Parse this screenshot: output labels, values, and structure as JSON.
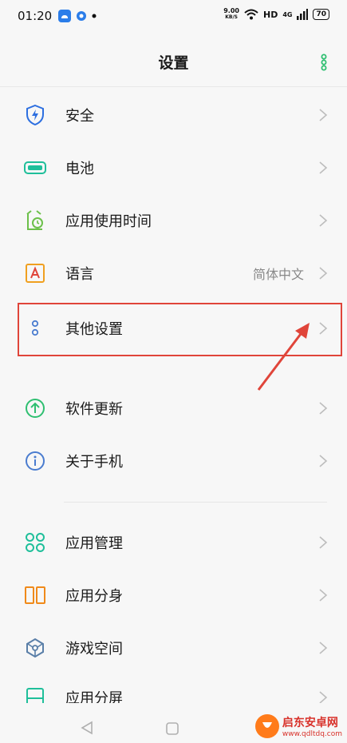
{
  "status_bar": {
    "time": "01:20",
    "network_speed_value": "9.00",
    "network_speed_unit": "KB/S",
    "hd": "HD",
    "signal": "4G",
    "battery": "70"
  },
  "header": {
    "title": "设置"
  },
  "settings": [
    {
      "label": "安全",
      "icon": "shield-icon",
      "value": ""
    },
    {
      "label": "电池",
      "icon": "battery-icon",
      "value": ""
    },
    {
      "label": "应用使用时间",
      "icon": "app-time-icon",
      "value": ""
    },
    {
      "label": "语言",
      "icon": "language-icon",
      "value": "简体中文"
    },
    {
      "label": "其他设置",
      "icon": "other-settings-icon",
      "value": ""
    },
    {
      "label": "软件更新",
      "icon": "update-icon",
      "value": ""
    },
    {
      "label": "关于手机",
      "icon": "info-icon",
      "value": ""
    },
    {
      "label": "应用管理",
      "icon": "app-management-icon",
      "value": ""
    },
    {
      "label": "应用分身",
      "icon": "app-clone-icon",
      "value": ""
    },
    {
      "label": "游戏空间",
      "icon": "game-space-icon",
      "value": ""
    },
    {
      "label": "应用分屏",
      "icon": "split-screen-icon",
      "value": ""
    }
  ],
  "watermark": {
    "name": "启东安卓网",
    "url": "www.qdltdq.com"
  },
  "colors": {
    "highlight": "#e0453a",
    "accent_green": "#2fbf71"
  }
}
